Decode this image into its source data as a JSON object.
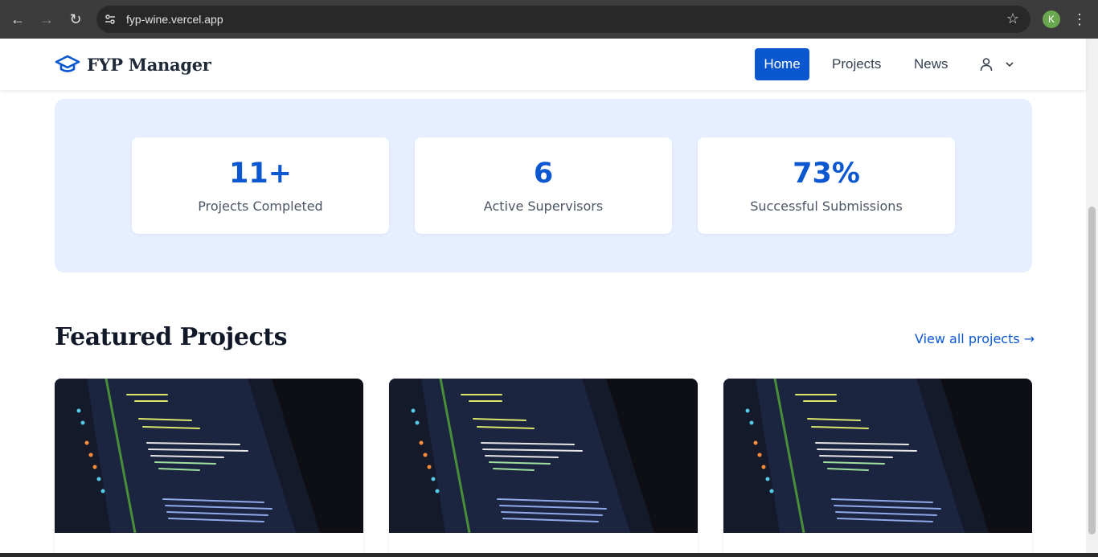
{
  "browser": {
    "url": "fyp-wine.vercel.app",
    "profile_initial": "K"
  },
  "header": {
    "brand": "FYP Manager",
    "nav": {
      "home": "Home",
      "projects": "Projects",
      "news": "News"
    }
  },
  "stats": [
    {
      "value": "11+",
      "label": "Projects Completed"
    },
    {
      "value": "6",
      "label": "Active Supervisors"
    },
    {
      "value": "73%",
      "label": "Successful Submissions"
    }
  ],
  "featured": {
    "title": "Featured Projects",
    "view_all": "View all projects →",
    "cards": [
      {
        "image": "code-screen-photo"
      },
      {
        "image": "code-screen-photo"
      },
      {
        "image": "code-screen-photo"
      }
    ]
  },
  "colors": {
    "accent": "#0b57d0",
    "stats_bg": "#e6efff"
  }
}
